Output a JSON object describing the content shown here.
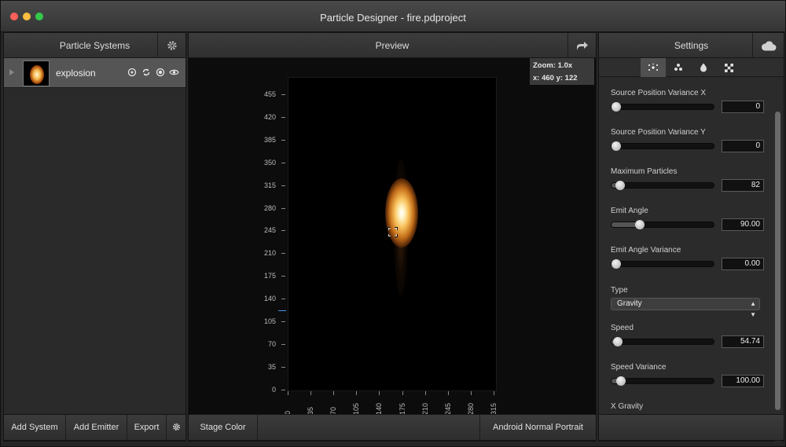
{
  "window": {
    "title": "Particle Designer - fire.pdproject"
  },
  "left_panel": {
    "header": "Particle Systems",
    "systems": [
      {
        "name": "explosion"
      }
    ],
    "bottom": {
      "add_system": "Add System",
      "add_emitter": "Add Emitter",
      "export": "Export"
    }
  },
  "center_panel": {
    "header": "Preview",
    "zoom": "Zoom: 1.0x",
    "coords": "x: 460 y: 122",
    "y_ticks": [
      "455",
      "420",
      "385",
      "350",
      "315",
      "280",
      "245",
      "210",
      "175",
      "140",
      "105",
      "70",
      "35",
      "0"
    ],
    "x_ticks": [
      "0",
      "35",
      "70",
      "105",
      "140",
      "175",
      "210",
      "245",
      "280",
      "315"
    ],
    "stage_color": "Stage Color",
    "device": "Android Normal Portrait"
  },
  "right_panel": {
    "header": "Settings",
    "settings": [
      {
        "label": "Source Position Variance X",
        "value": "0",
        "fraction": 0.0
      },
      {
        "label": "Source Position Variance Y",
        "value": "0",
        "fraction": 0.0
      },
      {
        "label": "Maximum Particles",
        "value": "82",
        "fraction": 0.04
      },
      {
        "label": "Emit Angle",
        "value": "90.00",
        "fraction": 0.25
      },
      {
        "label": "Emit Angle Variance",
        "value": "0.00",
        "fraction": 0.0
      }
    ],
    "type": {
      "label": "Type",
      "value": "Gravity"
    },
    "settings2": [
      {
        "label": "Speed",
        "value": "54.74",
        "fraction": 0.02
      },
      {
        "label": "Speed Variance",
        "value": "100.00",
        "fraction": 0.05
      }
    ],
    "x_gravity": {
      "label": "X Gravity"
    }
  }
}
